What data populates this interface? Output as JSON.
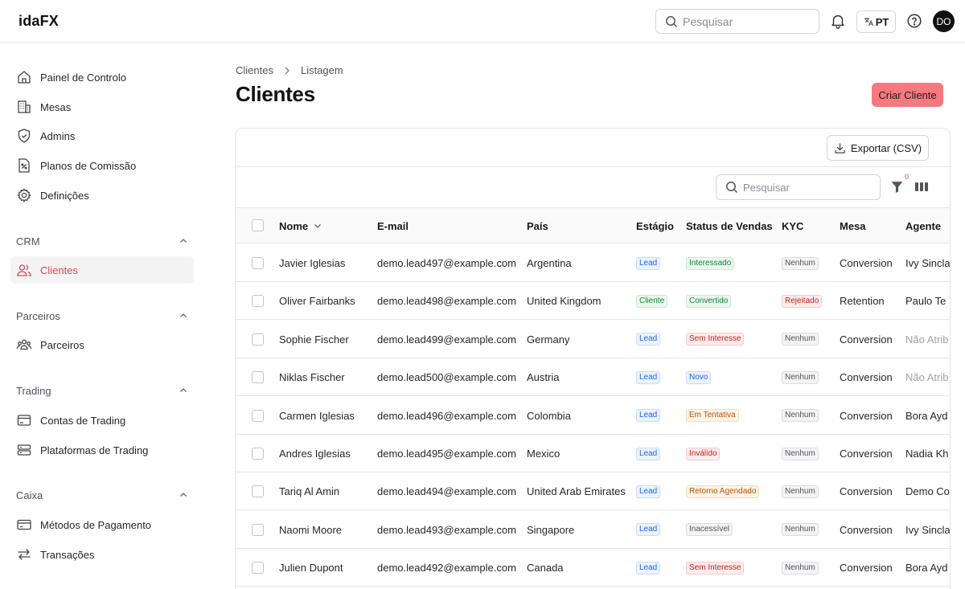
{
  "app": {
    "logo": "idaFX"
  },
  "topbar": {
    "search_placeholder": "Pesquisar",
    "language": "PT",
    "avatar_initials": "DO"
  },
  "sidebar": {
    "main_items": [
      {
        "label": "Painel de Controlo",
        "icon": "home-icon"
      },
      {
        "label": "Mesas",
        "icon": "building-icon"
      },
      {
        "label": "Admins",
        "icon": "shield-icon"
      },
      {
        "label": "Planos de Comissão",
        "icon": "commission-file-icon"
      },
      {
        "label": "Definições",
        "icon": "gear-icon"
      }
    ],
    "sections": [
      {
        "title": "CRM",
        "items": [
          {
            "label": "Clientes",
            "icon": "users-icon",
            "active": true
          }
        ]
      },
      {
        "title": "Parceiros",
        "items": [
          {
            "label": "Parceiros",
            "icon": "partners-icon"
          }
        ]
      },
      {
        "title": "Trading",
        "items": [
          {
            "label": "Contas de Trading",
            "icon": "trading-account-icon"
          },
          {
            "label": "Plataformas de Trading",
            "icon": "server-icon"
          }
        ]
      },
      {
        "title": "Caixa",
        "items": [
          {
            "label": "Métodos de Pagamento",
            "icon": "credit-card-icon"
          },
          {
            "label": "Transações",
            "icon": "arrows-exchange-icon"
          }
        ]
      }
    ]
  },
  "breadcrumb": [
    "Clientes",
    "Listagem"
  ],
  "page_title": "Clientes",
  "create_button": "Criar Cliente",
  "export_button": "Exportar (CSV)",
  "table_search_placeholder": "Pesquisar",
  "filter_count": "0",
  "colors": {
    "accent": "#f5797e",
    "active_text": "#e1434a"
  },
  "table": {
    "headers": {
      "name": "Nome",
      "email": "E-mail",
      "country": "País",
      "stage": "Estágio",
      "sales_status": "Status de Vendas",
      "kyc": "KYC",
      "desk": "Mesa",
      "agent": "Agente"
    },
    "rows": [
      {
        "name": "Javier Iglesias",
        "email": "demo.lead497@example.com",
        "country": "Argentina",
        "stage": "Lead",
        "stage_color": "blue",
        "status": "Interessado",
        "status_color": "green",
        "kyc": "Nenhum",
        "kyc_color": "gray",
        "desk": "Conversion",
        "agent": "Ivy Sincla",
        "agent_muted": false
      },
      {
        "name": "Oliver Fairbanks",
        "email": "demo.lead498@example.com",
        "country": "United Kingdom",
        "stage": "Cliente",
        "stage_color": "green",
        "status": "Convertido",
        "status_color": "green",
        "kyc": "Rejeitado",
        "kyc_color": "red",
        "desk": "Retention",
        "agent": "Paulo Te",
        "agent_muted": false
      },
      {
        "name": "Sophie Fischer",
        "email": "demo.lead499@example.com",
        "country": "Germany",
        "stage": "Lead",
        "stage_color": "blue",
        "status": "Sem Interesse",
        "status_color": "red",
        "kyc": "Nenhum",
        "kyc_color": "gray",
        "desk": "Conversion",
        "agent": "Não Atrib",
        "agent_muted": true
      },
      {
        "name": "Niklas Fischer",
        "email": "demo.lead500@example.com",
        "country": "Austria",
        "stage": "Lead",
        "stage_color": "blue",
        "status": "Novo",
        "status_color": "blue",
        "kyc": "Nenhum",
        "kyc_color": "gray",
        "desk": "Conversion",
        "agent": "Não Atrib",
        "agent_muted": true
      },
      {
        "name": "Carmen Iglesias",
        "email": "demo.lead496@example.com",
        "country": "Colombia",
        "stage": "Lead",
        "stage_color": "blue",
        "status": "Em Tentativa",
        "status_color": "orange",
        "kyc": "Nenhum",
        "kyc_color": "gray",
        "desk": "Conversion",
        "agent": "Bora Ayd",
        "agent_muted": false
      },
      {
        "name": "Andres Iglesias",
        "email": "demo.lead495@example.com",
        "country": "Mexico",
        "stage": "Lead",
        "stage_color": "blue",
        "status": "Inválido",
        "status_color": "red",
        "kyc": "Nenhum",
        "kyc_color": "gray",
        "desk": "Conversion",
        "agent": "Nadia Kh",
        "agent_muted": false
      },
      {
        "name": "Tariq Al Amin",
        "email": "demo.lead494@example.com",
        "country": "United Arab Emirates",
        "stage": "Lead",
        "stage_color": "blue",
        "status": "Retorno Agendado",
        "status_color": "orange",
        "kyc": "Nenhum",
        "kyc_color": "gray",
        "desk": "Conversion",
        "agent": "Demo Co",
        "agent_muted": false
      },
      {
        "name": "Naomi Moore",
        "email": "demo.lead493@example.com",
        "country": "Singapore",
        "stage": "Lead",
        "stage_color": "blue",
        "status": "Inacessível",
        "status_color": "gray",
        "kyc": "Nenhum",
        "kyc_color": "gray",
        "desk": "Conversion",
        "agent": "Ivy Sincla",
        "agent_muted": false
      },
      {
        "name": "Julien Dupont",
        "email": "demo.lead492@example.com",
        "country": "Canada",
        "stage": "Lead",
        "stage_color": "blue",
        "status": "Sem Interesse",
        "status_color": "red",
        "kyc": "Nenhum",
        "kyc_color": "gray",
        "desk": "Conversion",
        "agent": "Bora Ayd",
        "agent_muted": false
      }
    ]
  }
}
